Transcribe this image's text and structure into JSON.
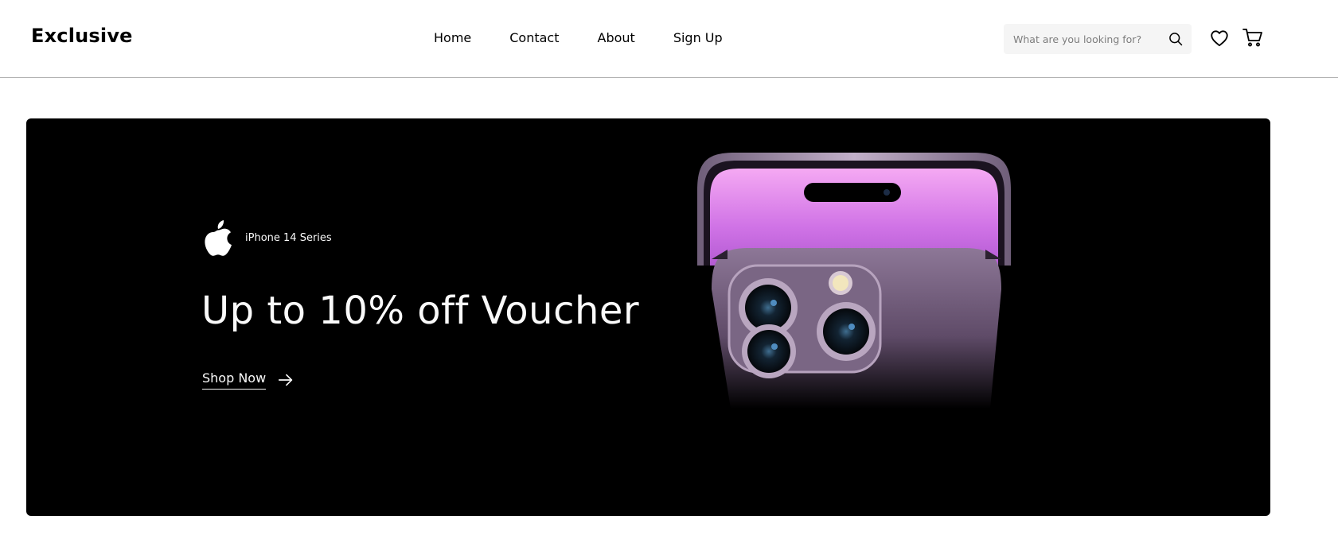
{
  "header": {
    "logo": "Exclusive",
    "nav": [
      {
        "label": "Home"
      },
      {
        "label": "Contact"
      },
      {
        "label": "About"
      },
      {
        "label": "Sign Up"
      }
    ],
    "search": {
      "placeholder": "What are you looking for?",
      "icon": "search-icon"
    },
    "icons": {
      "wishlist": "heart-icon",
      "cart": "cart-icon"
    }
  },
  "banner": {
    "brand_icon": "apple-logo",
    "brand_text": "iPhone 14 Series",
    "headline": "Up to 10% off Voucher",
    "cta_label": "Shop Now",
    "cta_icon": "arrow-right-icon",
    "image": "iphone-14-pro-purple-image"
  },
  "colors": {
    "banner_bg": "#000000",
    "banner_text": "#fafafa",
    "search_bg": "#f5f5f5",
    "phone_purple": "#8b7396"
  }
}
